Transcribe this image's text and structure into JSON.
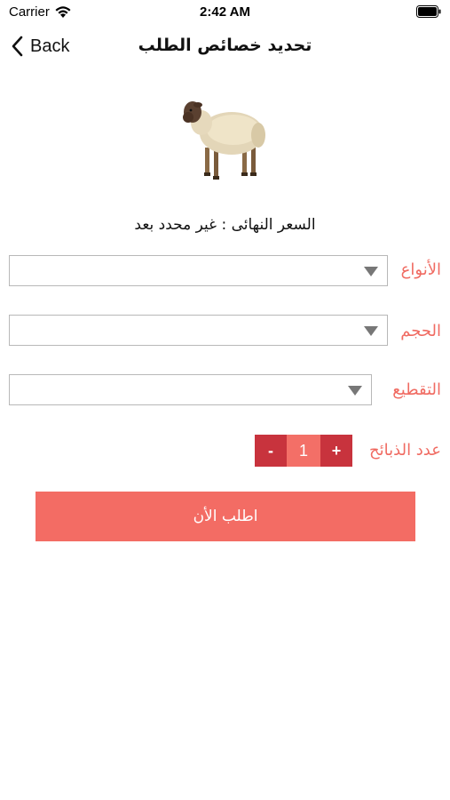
{
  "status_bar": {
    "carrier": "Carrier",
    "time": "2:42 AM"
  },
  "nav": {
    "back_label": "Back",
    "title": "تحديد خصائص الطلب"
  },
  "product": {
    "image_icon": "sheep-image"
  },
  "price": {
    "text": "السعر النهائى : غير محدد بعد"
  },
  "form": {
    "types": {
      "label": "الأنواع",
      "value": ""
    },
    "size": {
      "label": "الحجم",
      "value": ""
    },
    "cutting": {
      "label": "التقطيع",
      "value": ""
    },
    "quantity": {
      "label": "عدد الذبائح",
      "minus": "-",
      "plus": "+",
      "value": "1"
    }
  },
  "submit": {
    "label": "اطلب الأن"
  },
  "colors": {
    "accent": "#f36c64",
    "stepper_button": "#c8333d",
    "label": "#f06b62"
  }
}
